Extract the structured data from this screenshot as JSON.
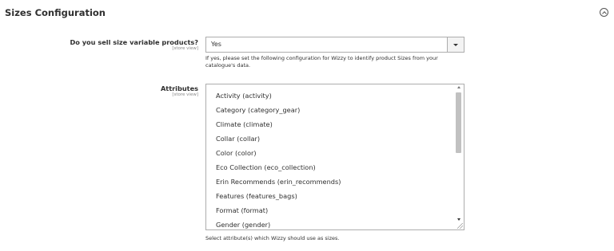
{
  "section": {
    "title": "Sizes Configuration"
  },
  "size_variable": {
    "label": "Do you sell size variable products?",
    "scope": "[store view]",
    "selected": "Yes",
    "note": "If yes, please set the following configuration for Wizzy to identify product Sizes from your catalogue's data."
  },
  "attributes": {
    "label": "Attributes",
    "scope": "[store view]",
    "options": [
      "Activity (activity)",
      "Category (category_gear)",
      "Climate (climate)",
      "Collar (collar)",
      "Color (color)",
      "Eco Collection (eco_collection)",
      "Erin Recommends (erin_recommends)",
      "Features (features_bags)",
      "Format (format)",
      "Gender (gender)"
    ],
    "note": "Select attribute(s) which Wizzy should use as sizes."
  },
  "icons": {
    "collapse": "chevron-up-circle-icon",
    "dropdown": "caret-down-icon"
  }
}
